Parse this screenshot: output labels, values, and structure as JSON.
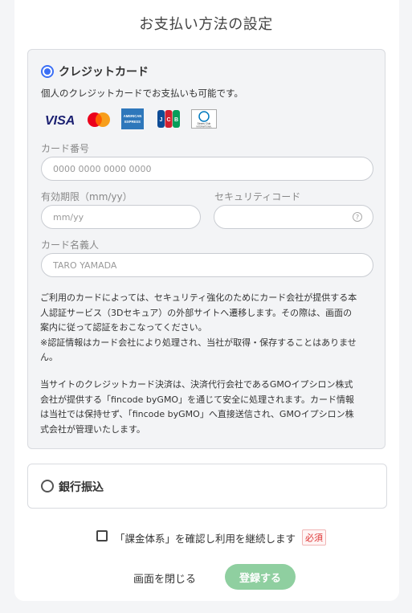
{
  "page": {
    "title": "お支払い方法の設定"
  },
  "credit_card": {
    "option_label": "クレジットカード",
    "selected": true,
    "description": "個人のクレジットカードでお支払いも可能です。",
    "brands": [
      {
        "name": "VISA",
        "icon": "visa-icon"
      },
      {
        "name": "Mastercard",
        "icon": "mastercard-icon"
      },
      {
        "name": "AMERICAN EXPRESS",
        "icon": "amex-icon"
      },
      {
        "name": "JCB",
        "icon": "jcb-icon"
      },
      {
        "name": "Diners Club INTERNATIONAL",
        "icon": "diners-icon"
      }
    ],
    "card_number": {
      "label": "カード番号",
      "placeholder": "0000 0000 0000 0000",
      "value": ""
    },
    "expiry": {
      "label": "有効期限（mm/yy）",
      "placeholder": "mm/yy",
      "value": ""
    },
    "security_code": {
      "label": "セキュリティコード",
      "placeholder": "",
      "value": "",
      "help_icon": "question-circle-icon",
      "help_glyph": "?"
    },
    "holder_name": {
      "label": "カード名義人",
      "placeholder": "TARO YAMADA",
      "value": ""
    },
    "notice_lines": [
      "ご利用のカードによっては、セキュリティ強化のためにカード会社が提供する本",
      "人認証サービス（3Dセキュア）の外部サイトへ遷移します。その際は、画面の",
      "案内に従って認証をおこなってください。",
      "※認証情報はカード会社により処理され、当社が取得・保存することはありませ",
      "ん。",
      "当サイトのクレジットカード決済は、決済代行会社であるGMOイプシロン株式",
      "会社が提供する「fincode byGMO」を通じて安全に処理されます。カード情報",
      "は当社では保持せず、「fincode byGMO」へ直接送信され、GMOイプシロン株",
      "式会社が管理いたします。"
    ]
  },
  "bank_transfer": {
    "option_label": "銀行振込",
    "selected": false
  },
  "agreement": {
    "label": "「課金体系」を確認し利用を継続します",
    "required_badge": "必須",
    "checked": false
  },
  "actions": {
    "close_label": "画面を閉じる",
    "register_label": "登録する"
  },
  "colors": {
    "accent": "#3b6ff5",
    "register": "#8fcfa0",
    "required": "#dd3333"
  }
}
